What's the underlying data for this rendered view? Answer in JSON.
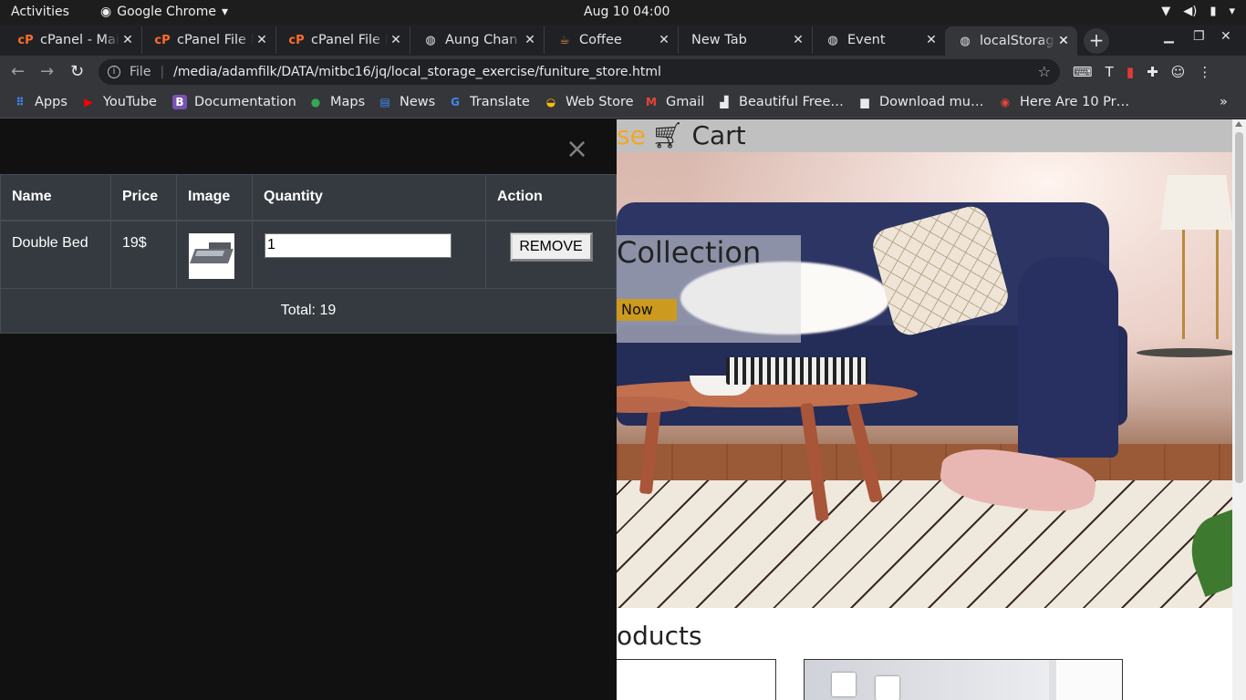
{
  "os": {
    "activities": "Activities",
    "app_name": "Google Chrome",
    "clock": "Aug 10  04:00"
  },
  "tabs": [
    {
      "title": "cPanel - Mail",
      "icon": "cpanel-icon"
    },
    {
      "title": "cPanel File Manager",
      "icon": "cpanel-icon"
    },
    {
      "title": "cPanel File Manager",
      "icon": "cpanel-icon"
    },
    {
      "title": "Aung Chan Oo",
      "icon": "globe-icon"
    },
    {
      "title": "Coffee",
      "icon": "cup-icon"
    },
    {
      "title": "New Tab",
      "icon": ""
    },
    {
      "title": "Event",
      "icon": "globe-icon"
    },
    {
      "title": "localStorage",
      "icon": "globe-icon"
    }
  ],
  "address": {
    "scheme": "File",
    "url": "/media/adamfilk/DATA/mitbc16/jq/local_storage_exercise/funiture_store.html"
  },
  "bookmarks": [
    {
      "label": "Apps",
      "icon": "apps-grid-icon"
    },
    {
      "label": "YouTube",
      "icon": "youtube-icon"
    },
    {
      "label": "Documentation",
      "icon": "bootstrap-icon"
    },
    {
      "label": "Maps",
      "icon": "maps-pin-icon"
    },
    {
      "label": "News",
      "icon": "news-icon"
    },
    {
      "label": "Translate",
      "icon": "translate-icon"
    },
    {
      "label": "Web Store",
      "icon": "webstore-icon"
    },
    {
      "label": "Gmail",
      "icon": "gmail-icon"
    },
    {
      "label": "Beautiful Free…",
      "icon": "bookmark-icon"
    },
    {
      "label": "Download mu…",
      "icon": "bookmark-icon"
    },
    {
      "label": "Here Are 10 Pr…",
      "icon": "bookmark-icon"
    }
  ],
  "site": {
    "brand_fragment": "se",
    "cart_label": "Cart",
    "hero_title_fragment": "Collection",
    "hero_button_fragment": "Now",
    "products_heading_fragment": "oducts"
  },
  "cart": {
    "columns": [
      "Name",
      "Price",
      "Image",
      "Quantity",
      "Action"
    ],
    "items": [
      {
        "name": "Double Bed",
        "price": "19$",
        "quantity": "1",
        "action": "REMOVE"
      }
    ],
    "total_text": "Total: 19"
  },
  "colors": {
    "brand": "#f5a623",
    "overlay_bg": "#111111",
    "table_bg": "#343a40",
    "hero_button": "#cc9a1f"
  }
}
